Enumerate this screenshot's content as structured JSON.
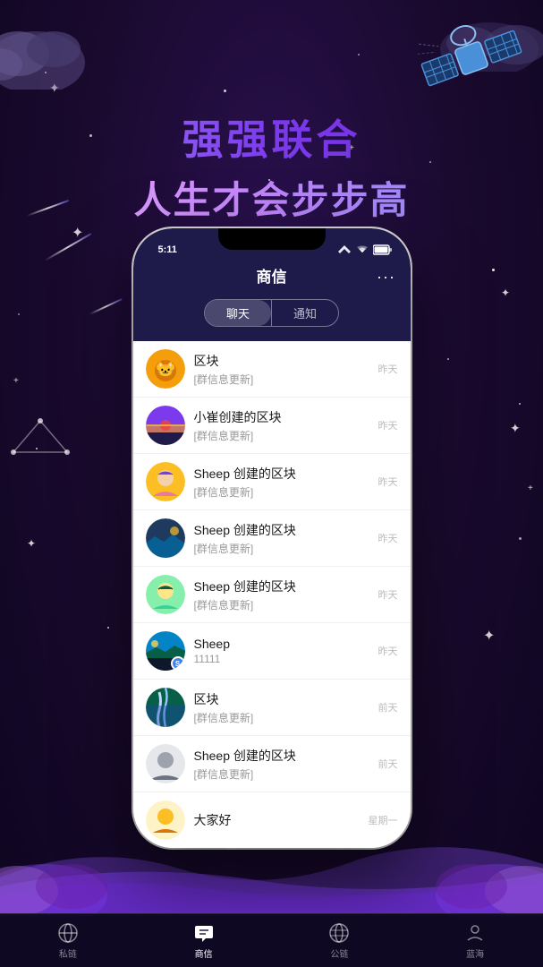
{
  "background": {
    "color": "#1a0a2e"
  },
  "headline": {
    "line1": "强强联合",
    "line2": "人生才会步步高"
  },
  "phone": {
    "status_bar": {
      "time": "5:11",
      "signal": "wifi",
      "battery": "100"
    },
    "header": {
      "title": "商信",
      "menu_icon": "..."
    },
    "tabs": [
      {
        "label": "聊天",
        "active": true
      },
      {
        "label": "通知",
        "active": false
      }
    ],
    "chat_list": [
      {
        "id": 1,
        "name": "区块",
        "preview": "[群信息更新]",
        "time": "昨天",
        "avatar_type": "cat"
      },
      {
        "id": 2,
        "name": "小崔创建的区块",
        "preview": "[群信息更新]",
        "time": "昨天",
        "avatar_type": "sunset"
      },
      {
        "id": 3,
        "name": "Sheep 创建的区块",
        "preview": "[群信息更新]",
        "time": "昨天",
        "avatar_type": "girl"
      },
      {
        "id": 4,
        "name": "Sheep 创建的区块",
        "preview": "[群信息更新]",
        "time": "昨天",
        "avatar_type": "dark"
      },
      {
        "id": 5,
        "name": "Sheep 创建的区块",
        "preview": "[群信息更新]",
        "time": "昨天",
        "avatar_type": "child"
      },
      {
        "id": 6,
        "name": "Sheep",
        "preview": "11111",
        "time": "昨天",
        "avatar_type": "landscape"
      },
      {
        "id": 7,
        "name": "区块",
        "preview": "[群信息更新]",
        "time": "前天",
        "avatar_type": "waterfall"
      },
      {
        "id": 8,
        "name": "Sheep 创建的区块",
        "preview": "[群信息更新]",
        "time": "前天",
        "avatar_type": "person"
      },
      {
        "id": 9,
        "name": "大家好",
        "preview": "",
        "time": "星期一",
        "avatar_type": "hello"
      }
    ]
  },
  "bottom_nav": {
    "items": [
      {
        "label": "私链",
        "icon": "chain-icon",
        "active": false
      },
      {
        "label": "商信",
        "icon": "chat-icon",
        "active": true
      },
      {
        "label": "公链",
        "icon": "globe-icon",
        "active": false
      },
      {
        "label": "蓝海",
        "icon": "person-icon",
        "active": false
      }
    ]
  }
}
